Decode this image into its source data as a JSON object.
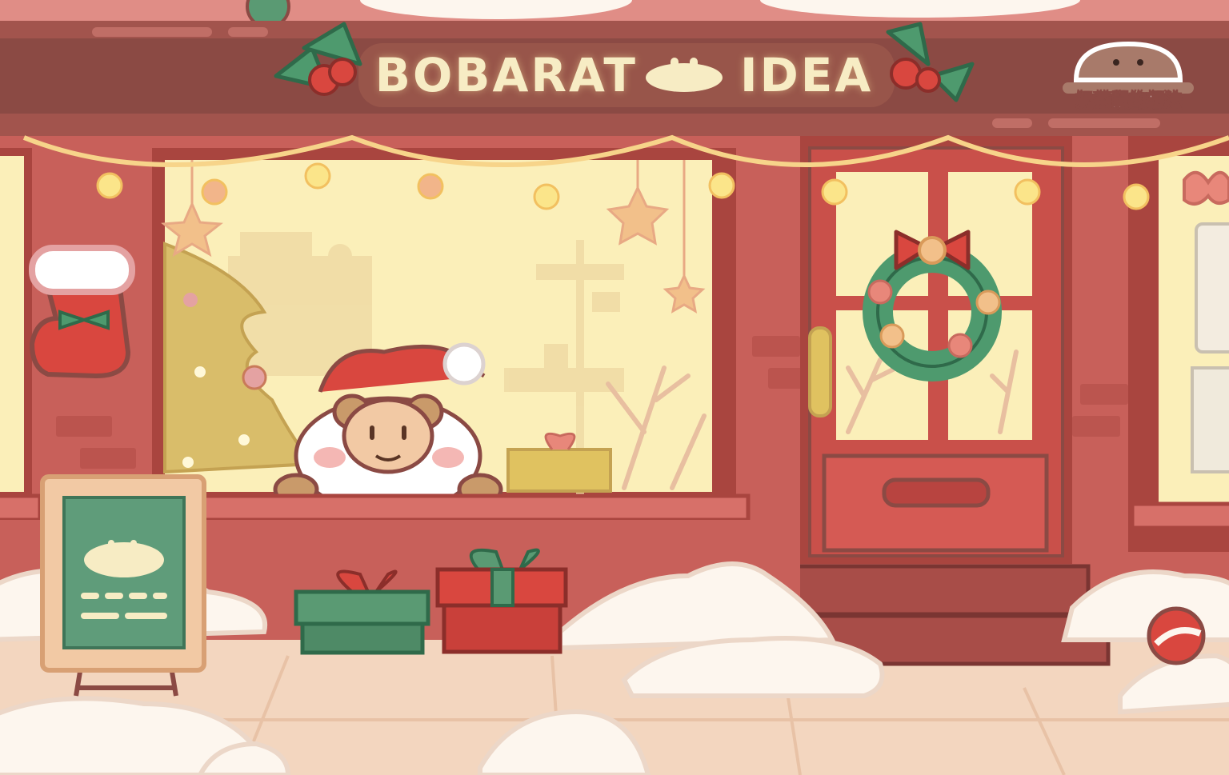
{
  "shop_sign": {
    "word_left": "BOBARAT",
    "word_right": "IDEA"
  },
  "logo": {
    "text": "奶茶鼠的想法"
  },
  "colors": {
    "wall": "#c8605a",
    "wall_dark": "#a9453f",
    "sign_band": "#8b4a44",
    "window_glow": "#fbefb9",
    "door": "#c9504a",
    "snow": "#fdf6ee",
    "sidewalk": "#f3d6bf",
    "gift_green": "#5a9a73",
    "gift_red": "#d9473f",
    "bow_red": "#e04a44",
    "chalkboard": "#5f9c7a",
    "bear_brown": "#8a5a3c"
  },
  "scene": {
    "characters": [
      "santa-bear"
    ],
    "decorations": [
      "string-lights",
      "christmas-wreath",
      "christmas-stocking",
      "christmas-tree",
      "hanging-stars",
      "holly-leaves"
    ]
  }
}
